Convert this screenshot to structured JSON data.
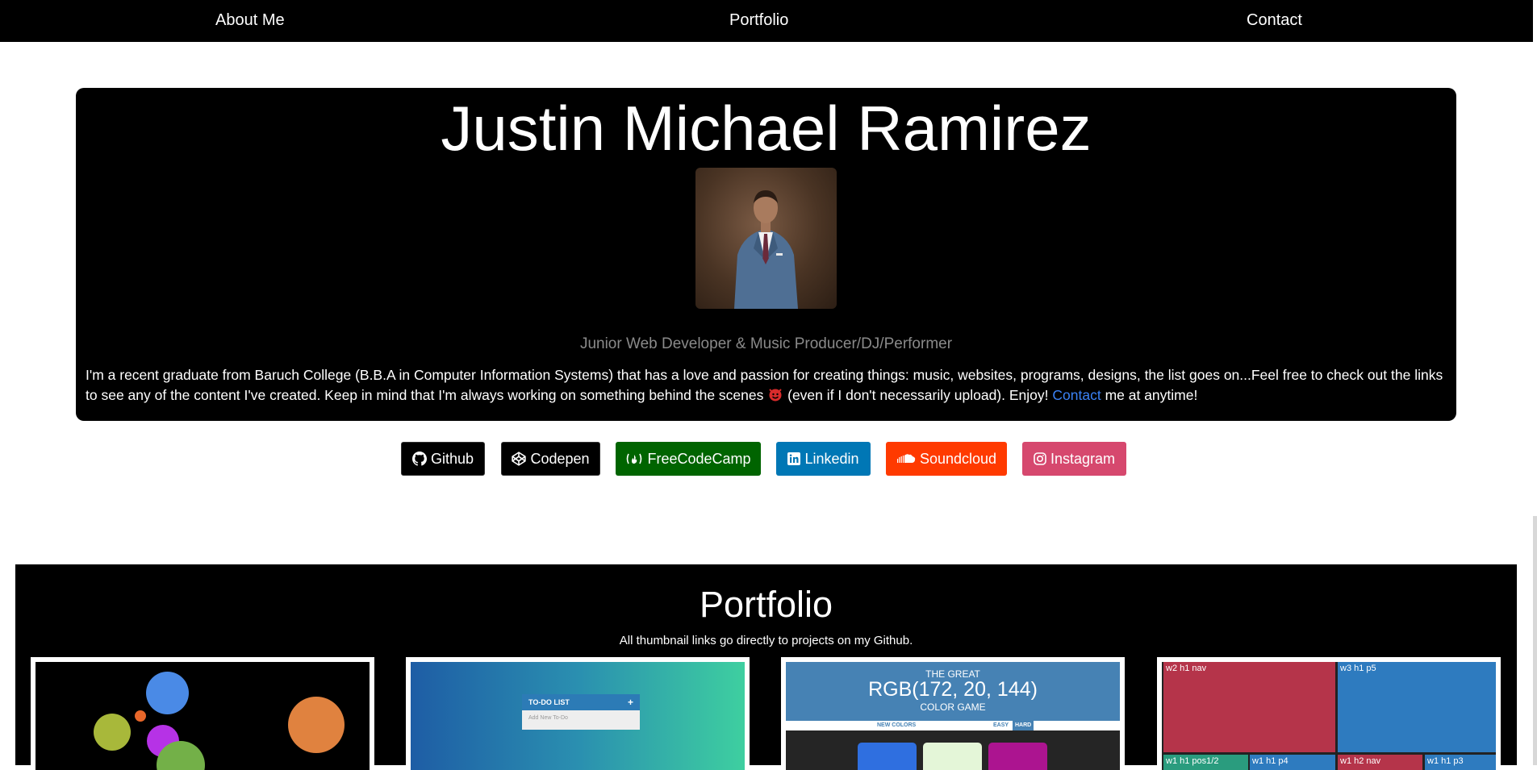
{
  "nav": {
    "items": [
      {
        "label": "About Me"
      },
      {
        "label": "Portfolio"
      },
      {
        "label": "Contact"
      }
    ]
  },
  "hero": {
    "name": "Justin Michael Ramirez",
    "subtitle": "Junior Web Developer & Music Producer/DJ/Performer",
    "bio_part1": "I'm a recent graduate from Baruch College (B.B.A in Computer Information Systems) that has a love and passion for creating things: music, websites, programs, designs, the list goes on...Feel free to check out the links to see any of the content I've created. Keep in mind that I'm always working on something behind the scenes",
    "bio_part2": "(even if I don't necessarily upload). Enjoy!",
    "contact_link": "Contact",
    "bio_part3": "me at anytime!",
    "avatar_icon": "profile-photo"
  },
  "links": [
    {
      "label": "Github",
      "icon": "github-icon",
      "color": "#000000"
    },
    {
      "label": "Codepen",
      "icon": "codepen-icon",
      "color": "#000000"
    },
    {
      "label": "FreeCodeCamp",
      "icon": "freecodecamp-icon",
      "color": "#006400"
    },
    {
      "label": "Linkedin",
      "icon": "linkedin-icon",
      "color": "#0077b5"
    },
    {
      "label": "Soundcloud",
      "icon": "soundcloud-icon",
      "color": "#ff3a00"
    },
    {
      "label": "Instagram",
      "icon": "instagram-icon",
      "color": "#d6486e"
    }
  ],
  "portfolio": {
    "title": "Portfolio",
    "note": "All thumbnail links go directly to projects on my Github.",
    "todo": {
      "header": "TO-DO LIST",
      "plus": "+",
      "placeholder": "Add New To-Do"
    },
    "rgb": {
      "line1": "THE GREAT",
      "line2": "RGB(172, 20, 144)",
      "line3": "COLOR GAME",
      "new_colors": "NEW COLORS",
      "easy": "EASY",
      "hard": "HARD"
    },
    "grid_labels": [
      "w2 h1 nav",
      "w3 h1 p5",
      "w1 h1 pos1/2",
      "w1 h1 p4",
      "w1 h2 nav",
      "w1 h1 p3"
    ]
  },
  "colors": {
    "navbar": "#000000",
    "contact_link": "#3b82f6",
    "subtitle": "#8a8a8a"
  }
}
